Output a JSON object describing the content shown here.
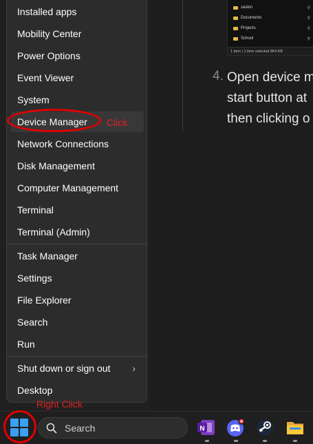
{
  "article": {
    "step_number": "4.",
    "step_lines": [
      "Open device m",
      "start button at",
      "then clicking o"
    ],
    "explorer": {
      "rows": [
        "saskin",
        "Documents",
        "Projects",
        "School"
      ],
      "status": "1 item  |  1 item selected  864 KB"
    }
  },
  "menu": {
    "items": [
      {
        "label": "Installed apps"
      },
      {
        "label": "Mobility Center"
      },
      {
        "label": "Power Options"
      },
      {
        "label": "Event Viewer"
      },
      {
        "label": "System"
      },
      {
        "label": "Device Manager"
      },
      {
        "label": "Network Connections"
      },
      {
        "label": "Disk Management"
      },
      {
        "label": "Computer Management"
      },
      {
        "label": "Terminal"
      },
      {
        "label": "Terminal (Admin)"
      },
      {
        "label": "Task Manager"
      },
      {
        "label": "Settings"
      },
      {
        "label": "File Explorer"
      },
      {
        "label": "Search"
      },
      {
        "label": "Run"
      },
      {
        "label": "Shut down or sign out"
      },
      {
        "label": "Desktop"
      }
    ],
    "submenu_chevron": "›"
  },
  "annotations": {
    "click": "Click",
    "right_click": "Right Click",
    "color": "#e10000"
  },
  "taskbar": {
    "search_placeholder": "Search",
    "icons": [
      "start-icon",
      "onenote-icon",
      "discord-icon",
      "steam-icon",
      "file-explorer-icon"
    ]
  }
}
